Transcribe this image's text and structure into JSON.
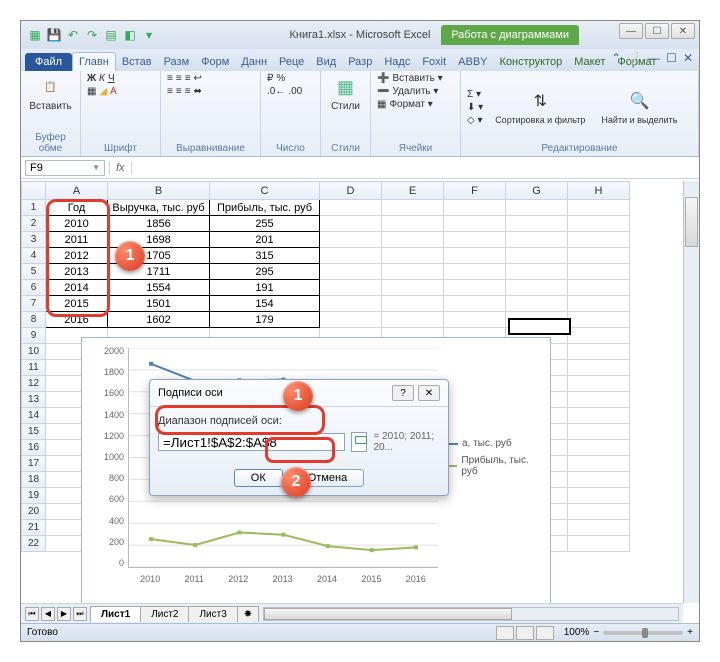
{
  "title": "Книга1.xlsx - Microsoft Excel",
  "chart_tools_label": "Работа с диаграммами",
  "tabs": {
    "file": "Файл",
    "home": "Главн",
    "insert": "Встав",
    "layout": "Разм",
    "formulas": "Форм",
    "data": "Данн",
    "review": "Реце",
    "view": "Вид",
    "developer": "Разр",
    "addins": "Надс",
    "foxit": "Foxit",
    "abbyy": "ABBY",
    "ctor": "Конструктор",
    "maket": "Макет",
    "format": "Формат"
  },
  "ribbon": {
    "paste": "Вставить",
    "clipboard": "Буфер обме",
    "font": "Шрифт",
    "alignment": "Выравнивание",
    "number": "Число",
    "styles_btn": "Стили",
    "styles": "Стили",
    "insert_row": "Вставить ▾",
    "delete_row": "Удалить ▾",
    "format_row": "Формат ▾",
    "cells": "Ячейки",
    "sortfilter": "Сортировка и фильтр",
    "findselect": "Найти и выделить",
    "editing": "Редактирование"
  },
  "namebox": "F9",
  "fx": "fx",
  "columns": [
    "A",
    "B",
    "C",
    "D",
    "E",
    "F",
    "G",
    "H"
  ],
  "header_row": {
    "year": "Год",
    "revenue": "Выручка, тыс. руб",
    "profit": "Прибыль, тыс. руб"
  },
  "rows": [
    {
      "n": 2,
      "year": "2010",
      "rev": "1856",
      "prof": "255"
    },
    {
      "n": 3,
      "year": "2011",
      "rev": "1698",
      "prof": "201"
    },
    {
      "n": 4,
      "year": "2012",
      "rev": "1705",
      "prof": "315"
    },
    {
      "n": 5,
      "year": "2013",
      "rev": "1711",
      "prof": "295"
    },
    {
      "n": 6,
      "year": "2014",
      "rev": "1554",
      "prof": "191"
    },
    {
      "n": 7,
      "year": "2015",
      "rev": "1501",
      "prof": "154"
    },
    {
      "n": 8,
      "year": "2016",
      "rev": "1602",
      "prof": "179"
    }
  ],
  "empty_rows": [
    9,
    10,
    11,
    12,
    13,
    14,
    15,
    16,
    17,
    18,
    19,
    20,
    21,
    22
  ],
  "chart_data": {
    "type": "line",
    "categories": [
      "2010",
      "2011",
      "2012",
      "2013",
      "2014",
      "2015",
      "2016"
    ],
    "series": [
      {
        "name": "а, тыс. руб",
        "values": [
          1856,
          1698,
          1705,
          1711,
          1554,
          1501,
          1602
        ],
        "color": "#4f81bd"
      },
      {
        "name": "Прибыль, тыс. руб",
        "values": [
          255,
          201,
          315,
          295,
          191,
          154,
          179
        ],
        "color": "#9bbb59"
      }
    ],
    "ylim": [
      0,
      2000
    ],
    "yticks": [
      0,
      200,
      400,
      600,
      800,
      1000,
      1200,
      1400,
      1600,
      1800,
      2000
    ]
  },
  "dialog": {
    "title": "Подписи оси",
    "label": "Диапазон подписей оси:",
    "input": "=Лист1!$A$2:$A$8",
    "preview": "= 2010; 2011; 20...",
    "ok": "ОК",
    "cancel": "Отмена"
  },
  "sheets": {
    "active": "Лист1",
    "s2": "Лист2",
    "s3": "Лист3"
  },
  "status": {
    "ready": "Готово",
    "zoom": "100%"
  },
  "badges": {
    "one": "1",
    "two": "2"
  }
}
